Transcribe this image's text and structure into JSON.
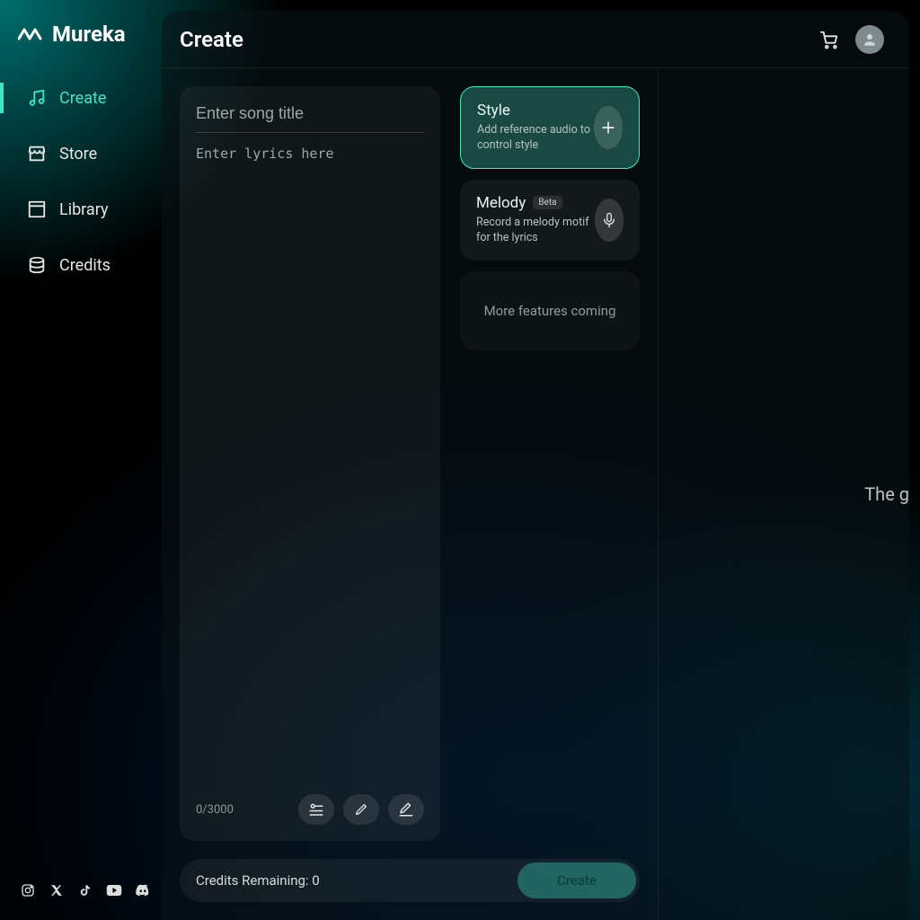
{
  "brand": {
    "name": "Mureka"
  },
  "sidebar": {
    "items": [
      {
        "label": "Create",
        "active": true
      },
      {
        "label": "Store"
      },
      {
        "label": "Library"
      },
      {
        "label": "Credits"
      }
    ]
  },
  "header": {
    "title": "Create"
  },
  "lyrics": {
    "title_placeholder": "Enter song title",
    "body_placeholder": "Enter lyrics here",
    "char_count": "0/3000"
  },
  "cards": {
    "style": {
      "title": "Style",
      "desc": "Add reference audio to control style"
    },
    "melody": {
      "title": "Melody",
      "badge": "Beta",
      "desc": "Record a melody motif for the lyrics"
    },
    "more": "More features coming"
  },
  "footer": {
    "credits_label": "Credits Remaining: 0",
    "create_label": "Create"
  },
  "preview": {
    "teaser": "The g"
  }
}
